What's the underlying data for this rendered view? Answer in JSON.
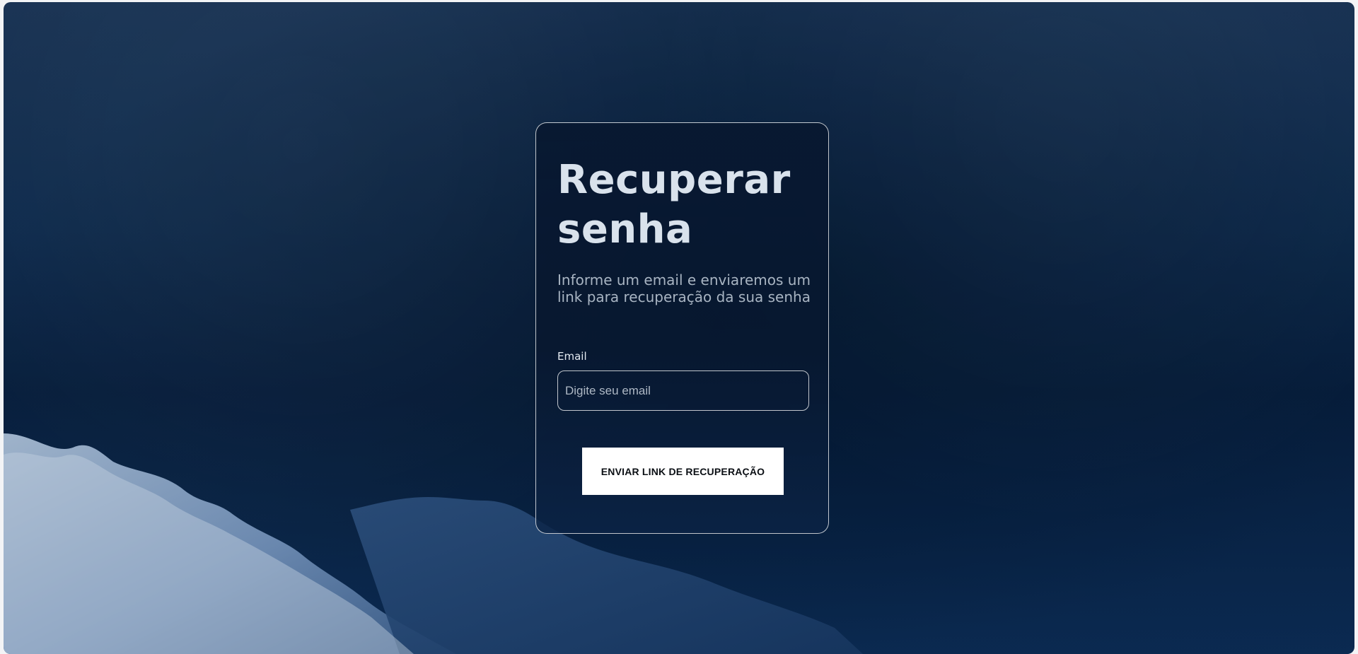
{
  "page": {
    "title": "Recuperar senha",
    "description": "Informe um email e enviaremos um link para recuperação da sua senha"
  },
  "form": {
    "email": {
      "label": "Email",
      "placeholder": "Digite seu email",
      "value": ""
    },
    "submit_label": "ENVIAR LINK DE RECUPERAÇÃO"
  }
}
